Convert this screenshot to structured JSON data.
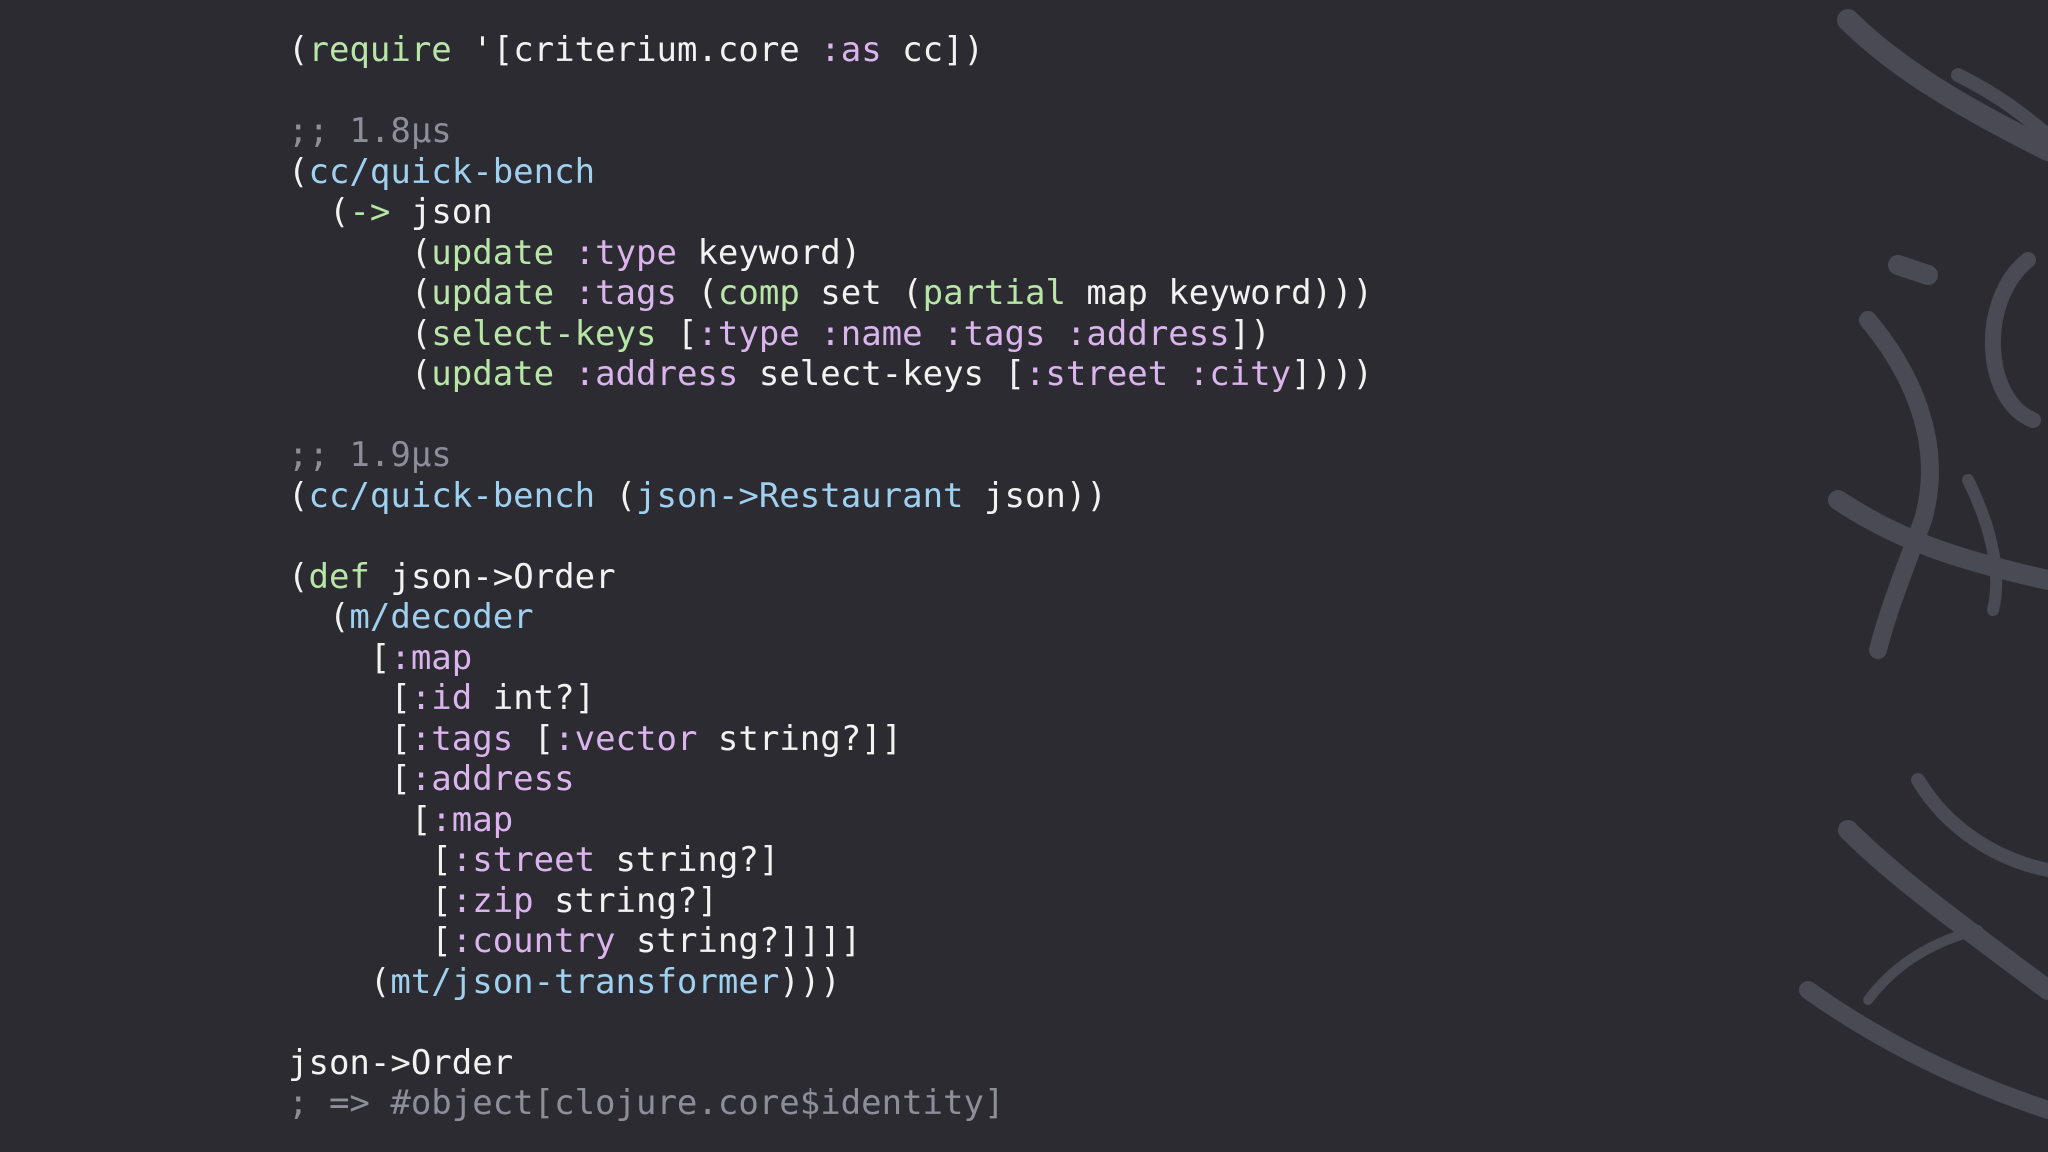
{
  "colors": {
    "background": "#2b2b31",
    "plain": "#f2f2f2",
    "function": "#b7e6a6",
    "keyword": "#dbb4ee",
    "namespace": "#9fd0ef",
    "comment": "#8e8e98",
    "logo": "#4a4a53"
  },
  "background_logo": {
    "icon": "metosin-brush-logo-icon"
  },
  "code_lines": [
    [
      {
        "t": "(",
        "k": "plain"
      },
      {
        "t": "require",
        "k": "fn"
      },
      {
        "t": " '[criterium.core ",
        "k": "plain"
      },
      {
        "t": ":as",
        "k": "kw"
      },
      {
        "t": " cc])",
        "k": "plain"
      }
    ],
    [],
    [
      {
        "t": ";; 1.8µs",
        "k": "comment"
      }
    ],
    [
      {
        "t": "(",
        "k": "plain"
      },
      {
        "t": "cc/quick-bench",
        "k": "ns"
      }
    ],
    [
      {
        "t": "  (",
        "k": "plain"
      },
      {
        "t": "->",
        "k": "fn"
      },
      {
        "t": " json",
        "k": "plain"
      }
    ],
    [
      {
        "t": "      (",
        "k": "plain"
      },
      {
        "t": "update",
        "k": "fn"
      },
      {
        "t": " ",
        "k": "plain"
      },
      {
        "t": ":type",
        "k": "kw"
      },
      {
        "t": " keyword)",
        "k": "plain"
      }
    ],
    [
      {
        "t": "      (",
        "k": "plain"
      },
      {
        "t": "update",
        "k": "fn"
      },
      {
        "t": " ",
        "k": "plain"
      },
      {
        "t": ":tags",
        "k": "kw"
      },
      {
        "t": " (",
        "k": "plain"
      },
      {
        "t": "comp",
        "k": "fn"
      },
      {
        "t": " set (",
        "k": "plain"
      },
      {
        "t": "partial",
        "k": "fn"
      },
      {
        "t": " map keyword)))",
        "k": "plain"
      }
    ],
    [
      {
        "t": "      (",
        "k": "plain"
      },
      {
        "t": "select-keys",
        "k": "fn"
      },
      {
        "t": " [",
        "k": "plain"
      },
      {
        "t": ":type",
        "k": "kw"
      },
      {
        "t": " ",
        "k": "plain"
      },
      {
        "t": ":name",
        "k": "kw"
      },
      {
        "t": " ",
        "k": "plain"
      },
      {
        "t": ":tags",
        "k": "kw"
      },
      {
        "t": " ",
        "k": "plain"
      },
      {
        "t": ":address",
        "k": "kw"
      },
      {
        "t": "])",
        "k": "plain"
      }
    ],
    [
      {
        "t": "      (",
        "k": "plain"
      },
      {
        "t": "update",
        "k": "fn"
      },
      {
        "t": " ",
        "k": "plain"
      },
      {
        "t": ":address",
        "k": "kw"
      },
      {
        "t": " select-keys [",
        "k": "plain"
      },
      {
        "t": ":street",
        "k": "kw"
      },
      {
        "t": " ",
        "k": "plain"
      },
      {
        "t": ":city",
        "k": "kw"
      },
      {
        "t": "])))",
        "k": "plain"
      }
    ],
    [],
    [
      {
        "t": ";; 1.9µs",
        "k": "comment"
      }
    ],
    [
      {
        "t": "(",
        "k": "plain"
      },
      {
        "t": "cc/quick-bench",
        "k": "ns"
      },
      {
        "t": " (",
        "k": "plain"
      },
      {
        "t": "json->Restaurant",
        "k": "ns"
      },
      {
        "t": " json))",
        "k": "plain"
      }
    ],
    [],
    [
      {
        "t": "(",
        "k": "plain"
      },
      {
        "t": "def",
        "k": "fn"
      },
      {
        "t": " json->Order",
        "k": "plain"
      }
    ],
    [
      {
        "t": "  (",
        "k": "plain"
      },
      {
        "t": "m/decoder",
        "k": "ns"
      }
    ],
    [
      {
        "t": "    [",
        "k": "plain"
      },
      {
        "t": ":map",
        "k": "kw"
      }
    ],
    [
      {
        "t": "     [",
        "k": "plain"
      },
      {
        "t": ":id",
        "k": "kw"
      },
      {
        "t": " int?]",
        "k": "plain"
      }
    ],
    [
      {
        "t": "     [",
        "k": "plain"
      },
      {
        "t": ":tags",
        "k": "kw"
      },
      {
        "t": " [",
        "k": "plain"
      },
      {
        "t": ":vector",
        "k": "kw"
      },
      {
        "t": " string?]]",
        "k": "plain"
      }
    ],
    [
      {
        "t": "     [",
        "k": "plain"
      },
      {
        "t": ":address",
        "k": "kw"
      }
    ],
    [
      {
        "t": "      [",
        "k": "plain"
      },
      {
        "t": ":map",
        "k": "kw"
      }
    ],
    [
      {
        "t": "       [",
        "k": "plain"
      },
      {
        "t": ":street",
        "k": "kw"
      },
      {
        "t": " string?]",
        "k": "plain"
      }
    ],
    [
      {
        "t": "       [",
        "k": "plain"
      },
      {
        "t": ":zip",
        "k": "kw"
      },
      {
        "t": " string?]",
        "k": "plain"
      }
    ],
    [
      {
        "t": "       [",
        "k": "plain"
      },
      {
        "t": ":country",
        "k": "kw"
      },
      {
        "t": " string?]]]]",
        "k": "plain"
      }
    ],
    [
      {
        "t": "    (",
        "k": "plain"
      },
      {
        "t": "mt/json-transformer",
        "k": "ns"
      },
      {
        "t": ")))",
        "k": "plain"
      }
    ],
    [],
    [
      {
        "t": "json->Order",
        "k": "plain"
      }
    ],
    [
      {
        "t": "; => #object[clojure.core$identity]",
        "k": "comment"
      }
    ]
  ]
}
